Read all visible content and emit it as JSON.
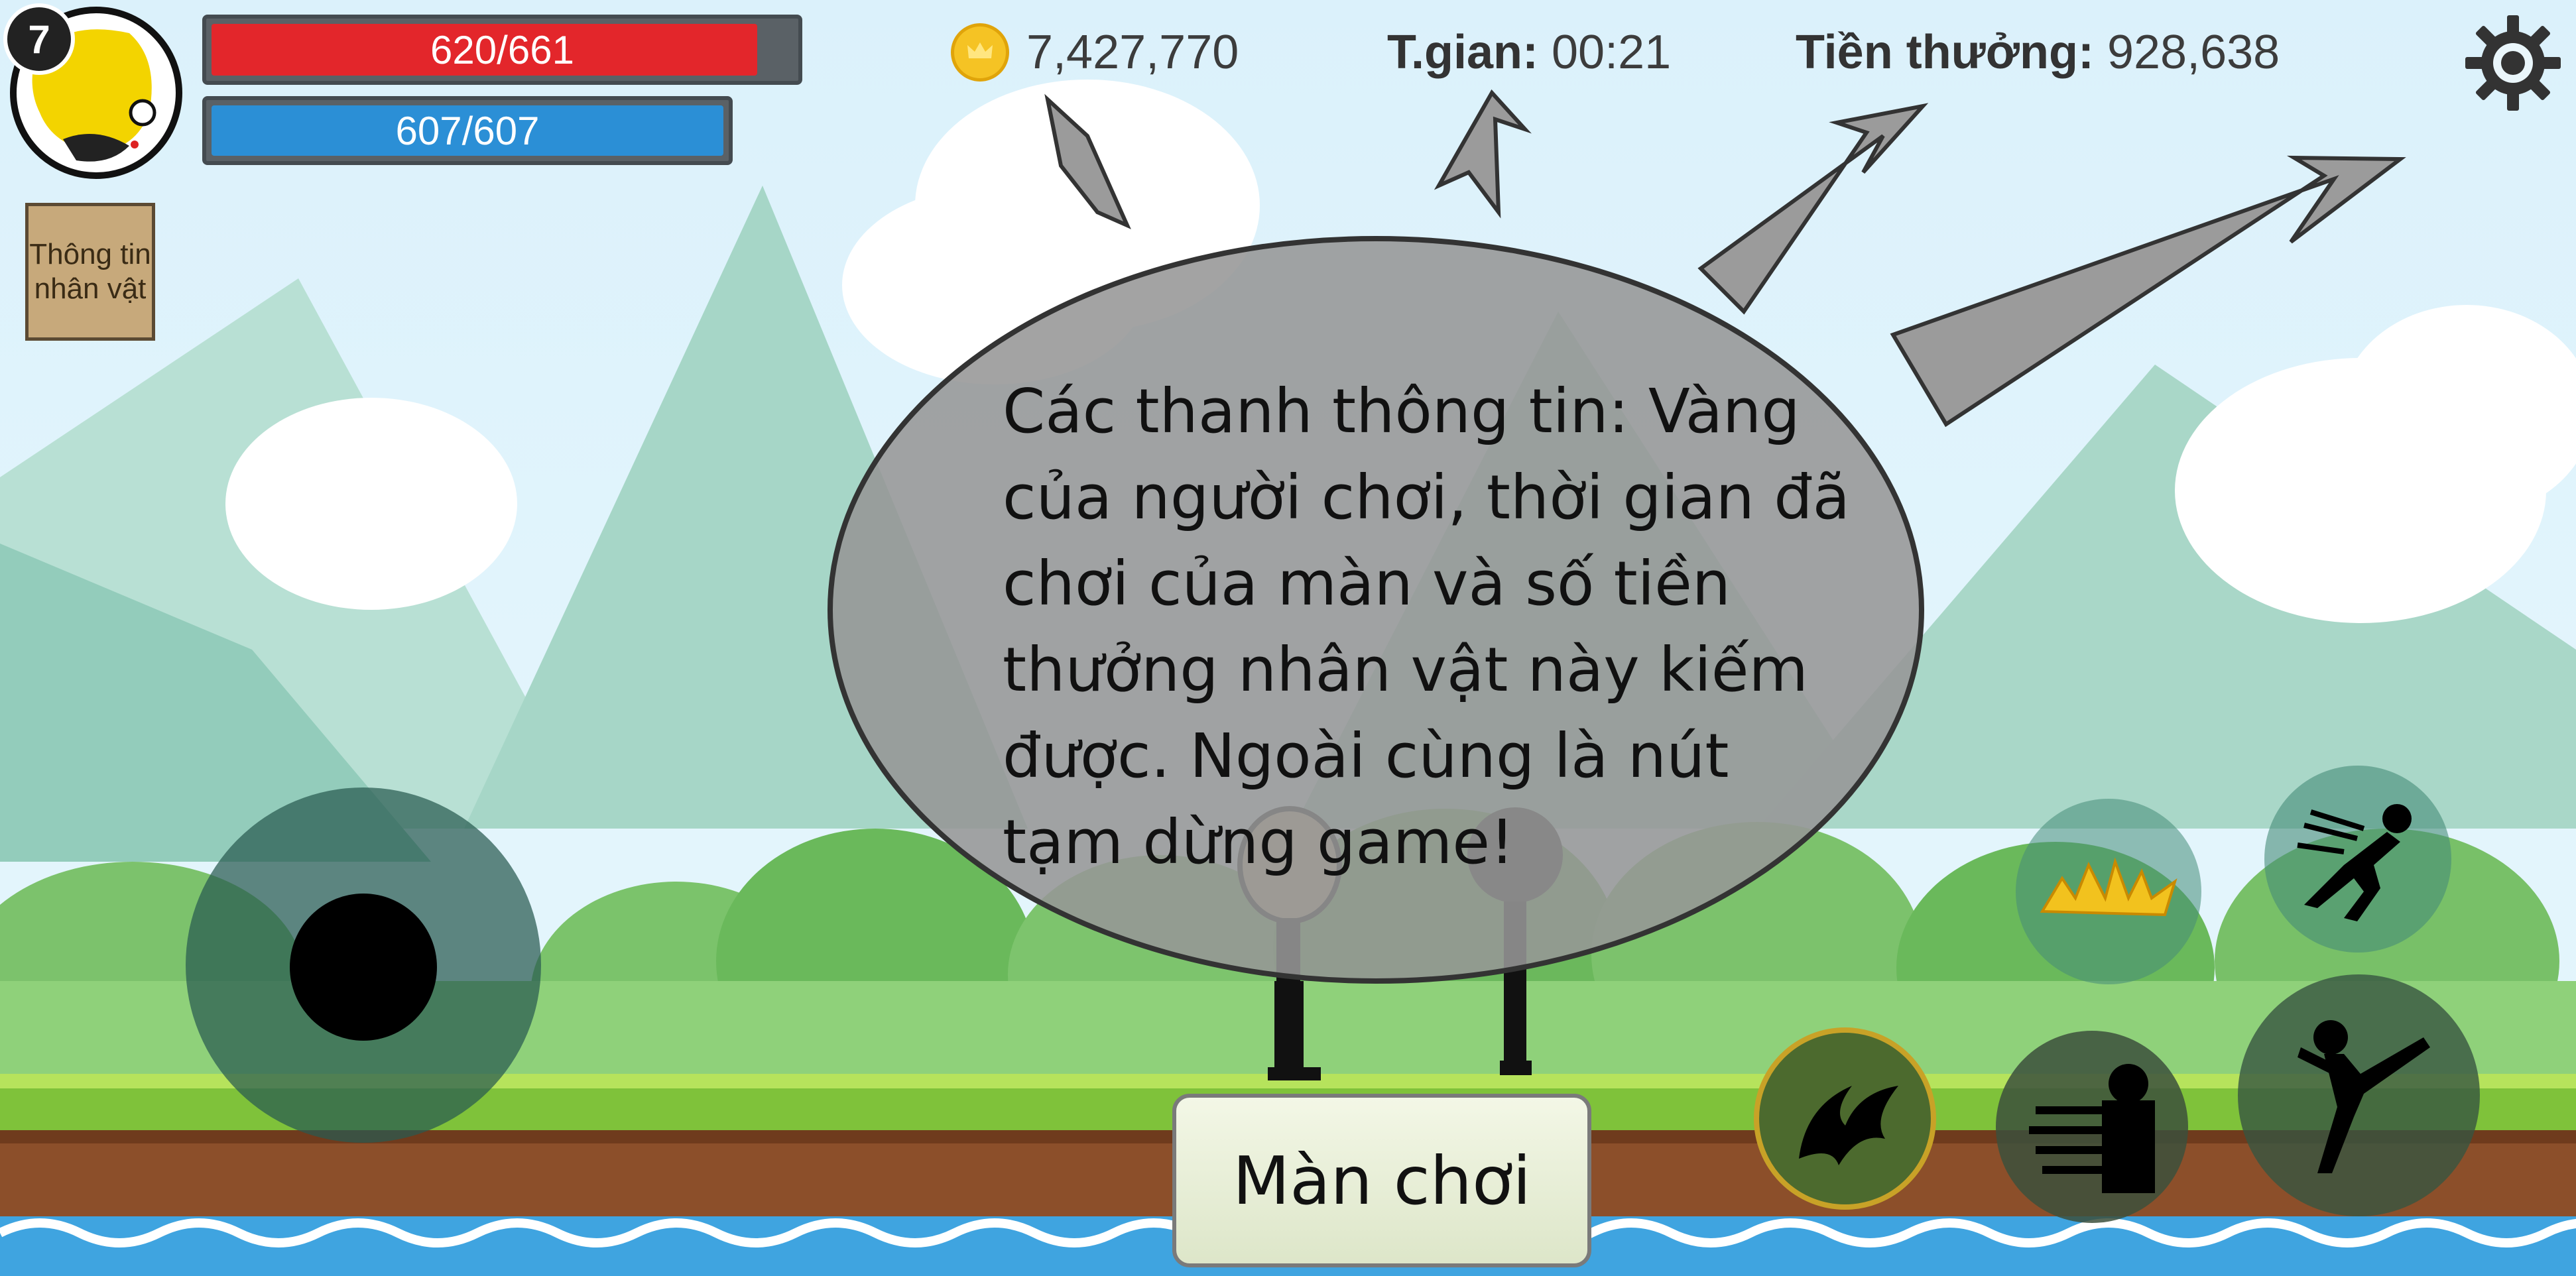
{
  "player": {
    "level": "7",
    "hp_text": "620/661",
    "hp_fraction": 0.938,
    "mp_text": "607/607",
    "mp_fraction": 1.0,
    "info_button_line1": "Thông tin",
    "info_button_line2": "nhân vật"
  },
  "hud": {
    "gold_value": "7,427,770",
    "time_label": "T.gian:",
    "time_value": "00:21",
    "reward_label": "Tiền thưởng:",
    "reward_value": "928,638"
  },
  "tutorial": {
    "message": "Các thanh thông tin: Vàng\ncủa người chơi, thời gian đã\nchơi của màn và số tiền\nthưởng nhân vật này kiếm\nđược. Ngoài cùng là nút\ntạm dừng game!"
  },
  "menu": {
    "level_button_label": "Màn chơi"
  },
  "icons": {
    "gold": "coin-icon",
    "settings": "gear-icon",
    "skill_1": "flame-burst-icon",
    "skill_2": "dash-silhouette-icon",
    "skill_3": "fire-swirl-icon",
    "skill_4": "multi-punch-icon",
    "attack": "flying-kick-icon"
  },
  "colors": {
    "hp_bar": "#e3262b",
    "mp_bar": "#2b8fd6",
    "coin": "#f5c324",
    "bubble": "#9a9a9a",
    "arrow": "#9b9b9b",
    "grass": "#7fc23a",
    "dirt": "#8c4f2a",
    "water": "#3fa4e0"
  }
}
